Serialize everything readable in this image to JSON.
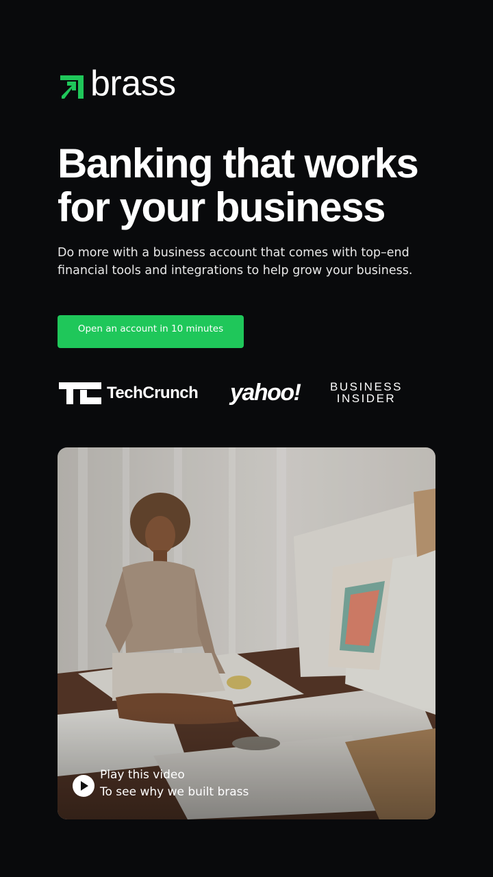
{
  "brand": {
    "name": "brass",
    "accent": "#1fc75a",
    "background": "#090a0c"
  },
  "hero": {
    "headline_line1": "Banking that works",
    "headline_line2": "for your business",
    "subtext": "Do more with a business account that comes with top–end financial tools and integrations to help grow your business.",
    "cta_label": "Open an account in 10 minutes"
  },
  "press": {
    "techcrunch": "TechCrunch",
    "yahoo": "yahoo!",
    "business_insider_line1": "BUSINESS",
    "business_insider_line2": "INSIDER"
  },
  "video": {
    "play_icon": "play-icon",
    "caption_line1": "Play this video",
    "caption_line2": "To see why we built brass"
  }
}
